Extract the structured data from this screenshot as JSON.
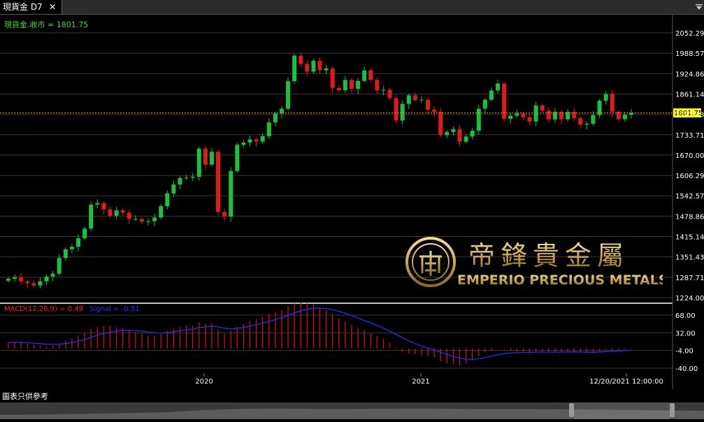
{
  "tab": {
    "title": "現貨金 D7",
    "close_glyph": "✕"
  },
  "price_panel": {
    "legend_label": "現貨金.收市 = 1801.75",
    "current_price_tag": "1801.75",
    "y_tick_labels": [
      "2052.29",
      "1988.57",
      "1924.86",
      "1861.14",
      "1797.43",
      "1733.71",
      "1670.00",
      "1606.29",
      "1542.57",
      "1478.86",
      "1415.14",
      "1351.43",
      "1287.71",
      "1224.00"
    ],
    "y_min": 1224.0,
    "y_max": 2052.29,
    "current_price": 1801.75
  },
  "macd_panel": {
    "label_macd": "MACD(12,26,9) = 0.49",
    "label_signal": "Signal = -0.51",
    "y_tick_labels": [
      "68.00",
      "32.00",
      "-4.00",
      "-40.00"
    ],
    "y_ticks": [
      68,
      32,
      -4,
      -40
    ]
  },
  "x_axis": {
    "labels": [
      "2020",
      "2021",
      "12/20/2021 12:00:00"
    ]
  },
  "logo": {
    "name_zh": "帝鋒貴金屬",
    "name_en": "EMPERIO PRECIOUS METALS"
  },
  "footer_note": "圖表只供參考",
  "colors": {
    "up": "#19c23c",
    "down": "#e21a1a",
    "grid": "#3a3a3a",
    "axis_text": "#ffffff",
    "price_tag": "#ffff00",
    "signal": "#2030ff",
    "gold": "#c9a84c",
    "legend_green": "#3ddc3d",
    "macd_red": "#ff2020"
  },
  "chart_data": {
    "type": "candlestick",
    "series_close_approx": [
      1283,
      1288,
      1275,
      1269,
      1262,
      1275,
      1290,
      1299,
      1348,
      1375,
      1383,
      1410,
      1440,
      1515,
      1520,
      1500,
      1480,
      1497,
      1490,
      1470,
      1470,
      1462,
      1463,
      1475,
      1510,
      1550,
      1578,
      1598,
      1599,
      1602,
      1690,
      1640,
      1680,
      1492,
      1477,
      1620,
      1702,
      1709,
      1719,
      1712,
      1729,
      1772,
      1800,
      1815,
      1901,
      1981,
      1955,
      1931,
      1965,
      1935,
      1941,
      1880,
      1873,
      1905,
      1877,
      1902,
      1935,
      1905,
      1872,
      1874,
      1848,
      1778,
      1830,
      1857,
      1842,
      1843,
      1812,
      1805,
      1732,
      1742,
      1751,
      1712,
      1728,
      1746,
      1815,
      1843,
      1872,
      1894,
      1783,
      1793,
      1800,
      1788,
      1775,
      1825,
      1809,
      1781,
      1805,
      1782,
      1805,
      1785,
      1765,
      1768,
      1795,
      1840,
      1861,
      1805,
      1782,
      1796,
      1801.75
    ],
    "macd_approx": [
      12,
      14,
      12,
      10,
      8,
      6,
      5,
      6,
      10,
      16,
      20,
      26,
      32,
      40,
      44,
      46,
      46,
      44,
      42,
      38,
      34,
      30,
      26,
      26,
      30,
      36,
      40,
      44,
      46,
      46,
      54,
      50,
      52,
      38,
      30,
      36,
      44,
      50,
      56,
      60,
      64,
      70,
      74,
      78,
      86,
      92,
      94,
      92,
      90,
      84,
      78,
      70,
      62,
      56,
      48,
      42,
      38,
      32,
      26,
      20,
      12,
      2,
      -6,
      -10,
      -12,
      -14,
      -16,
      -18,
      -26,
      -30,
      -32,
      -34,
      -30,
      -24,
      -16,
      -8,
      -4,
      0,
      -2,
      -4,
      -6,
      -6,
      -7,
      -6,
      -7,
      -8,
      -7,
      -8,
      -6,
      -6,
      -8,
      -9,
      -8,
      -5,
      -2,
      -3,
      -3,
      -2,
      0.49
    ],
    "x_labels": [
      "2020",
      "2021"
    ]
  }
}
